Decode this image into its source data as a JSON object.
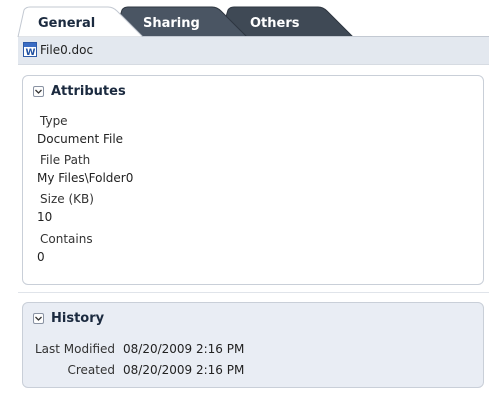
{
  "tabs": [
    {
      "label": "General",
      "active": true
    },
    {
      "label": "Sharing",
      "active": false
    },
    {
      "label": "Others",
      "active": false
    }
  ],
  "file": {
    "name": "File0.doc",
    "icon": "word-document-icon"
  },
  "attributes": {
    "title": "Attributes",
    "items": [
      {
        "label": "Type",
        "value": "Document File"
      },
      {
        "label": "File Path",
        "value": "My Files\\Folder0"
      },
      {
        "label": "Size (KB)",
        "value": "10"
      },
      {
        "label": "Contains",
        "value": "0"
      }
    ]
  },
  "history": {
    "title": "History",
    "rows": [
      {
        "label": "Last Modified",
        "value": "08/20/2009 2:16 PM"
      },
      {
        "label": "Created",
        "value": "08/20/2009 2:16 PM"
      }
    ]
  },
  "colors": {
    "active_tab": "#ffffff",
    "inactive_tab": "#45505e",
    "strip": "#e3e8ef",
    "history_panel": "#e9edf4"
  }
}
